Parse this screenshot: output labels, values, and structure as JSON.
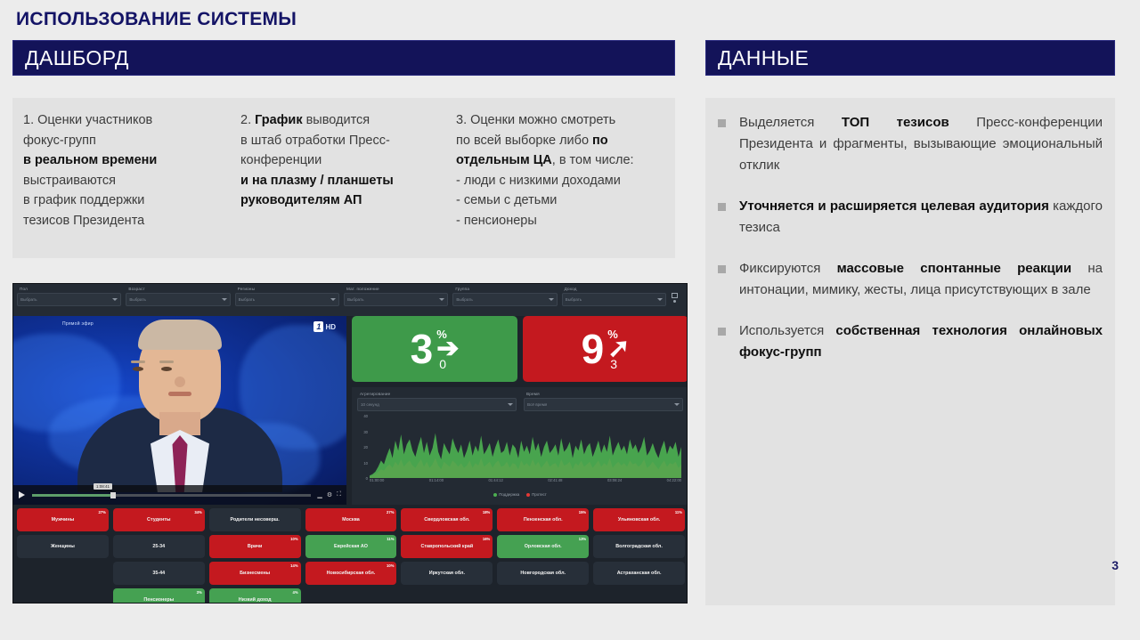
{
  "slide": {
    "title": "ИСПОЛЬЗОВАНИЕ СИСТЕМЫ",
    "page_number": "3",
    "accent_navy": "#131359",
    "panel_grey": "#e2e2e2",
    "slide_bg": "#ececec"
  },
  "headers": {
    "dashboard": "ДАШБОРД",
    "data": "ДАННЫЕ"
  },
  "columns": [
    {
      "id": "col-1",
      "segments": [
        {
          "text": "1. Оценки участников\nфокус-групп\n",
          "bold": false
        },
        {
          "text": "в реальном времени",
          "bold": true
        },
        {
          "text": "\nвыстраиваются\nв график поддержки\nтезисов Президента",
          "bold": false
        }
      ]
    },
    {
      "id": "col-2",
      "segments": [
        {
          "text": "2. ",
          "bold": false
        },
        {
          "text": "График",
          "bold": true
        },
        {
          "text": " выводится\nв штаб отработки Пресс-\nконференции\n",
          "bold": false
        },
        {
          "text": "и на плазму / планшеты\nруководителям АП",
          "bold": true
        }
      ]
    },
    {
      "id": "col-3",
      "segments": [
        {
          "text": "3. Оценки можно смотреть\nпо всей выборке либо ",
          "bold": false
        },
        {
          "text": "по\nотдельным ЦА",
          "bold": true
        },
        {
          "text": ", в том числе:\n- люди с низкими доходами\n- семьи с детьми\n- пенсионеры",
          "bold": false
        }
      ]
    }
  ],
  "data_bullets": [
    {
      "id": "bullet-1",
      "segments": [
        {
          "text": "Выделяется ",
          "bold": false
        },
        {
          "text": "ТОП тезисов",
          "bold": true
        },
        {
          "text": " Пресс-конференции Президента и фрагменты, вызывающие эмоциональный отклик",
          "bold": false
        }
      ]
    },
    {
      "id": "bullet-2",
      "segments": [
        {
          "text": "Уточняется и расширяется целевая аудитория",
          "bold": true
        },
        {
          "text": " каждого тезиса",
          "bold": false
        }
      ]
    },
    {
      "id": "bullet-3",
      "segments": [
        {
          "text": "Фиксируются ",
          "bold": false
        },
        {
          "text": "массовые спонтанные реакции",
          "bold": true
        },
        {
          "text": " на интонации, мимику, жесты, лица присутствующих в зале",
          "bold": false
        }
      ]
    },
    {
      "id": "bullet-4",
      "segments": [
        {
          "text": "Используется ",
          "bold": false
        },
        {
          "text": "собственная технология онлайновых фокус-групп",
          "bold": true
        }
      ]
    }
  ],
  "dashboard": {
    "toolbar_filters": [
      {
        "label": "Пол",
        "value": "Выбрать"
      },
      {
        "label": "Возраст",
        "value": "Выбрать"
      },
      {
        "label": "Регионы",
        "value": "Выбрать"
      },
      {
        "label": "Мат. положение",
        "value": "Выбрать"
      },
      {
        "label": "Группа",
        "value": "Выбрать"
      },
      {
        "label": "Доход",
        "value": "Выбрать"
      }
    ],
    "video": {
      "live_label": "Прямой эфир",
      "channel_logo_mark": "1",
      "channel_logo_hd": "HD",
      "time_tooltip": "1:08:41",
      "progress_percent": 28
    },
    "kpi": [
      {
        "id": "kpi-green",
        "value": "3",
        "percent_symbol": "%",
        "arrow": "➔",
        "sub": "0",
        "color": "#3e9a4a"
      },
      {
        "id": "kpi-red",
        "value": "9",
        "percent_symbol": "%",
        "arrow": "➚",
        "sub": "3",
        "color": "#c4191f"
      }
    ],
    "chart_filters": [
      {
        "label": "Агрегирование",
        "value": "10 секунд"
      },
      {
        "label": "Время",
        "value": "Всё время"
      }
    ],
    "segment_tiles": [
      {
        "label": "Мужчины",
        "pct": "27%",
        "state": "red"
      },
      {
        "label": "Студенты",
        "pct": "34%",
        "state": "red"
      },
      {
        "label": "Родители несоверш.",
        "pct": "",
        "state": "neutral"
      },
      {
        "label": "Москва",
        "pct": "27%",
        "state": "red"
      },
      {
        "label": "Свердловская обл.",
        "pct": "18%",
        "state": "red"
      },
      {
        "label": "Пензенская обл.",
        "pct": "15%",
        "state": "red"
      },
      {
        "label": "Ульяновская обл.",
        "pct": "11%",
        "state": "red"
      },
      {
        "label": "Женщины",
        "pct": "",
        "state": "neutral"
      },
      {
        "label": "25-34",
        "pct": "",
        "state": "neutral"
      },
      {
        "label": "Врачи",
        "pct": "10%",
        "state": "red"
      },
      {
        "label": "Еврейская АО",
        "pct": "11%",
        "state": "green"
      },
      {
        "label": "Ставропольский край",
        "pct": "16%",
        "state": "red"
      },
      {
        "label": "Орловская обл.",
        "pct": "13%",
        "state": "green"
      },
      {
        "label": "Волгоградская обл.",
        "pct": "",
        "state": "neutral"
      },
      {
        "label": "",
        "pct": "",
        "state": "empty"
      },
      {
        "label": "35-44",
        "pct": "",
        "state": "neutral"
      },
      {
        "label": "Бизнесмены",
        "pct": "14%",
        "state": "red"
      },
      {
        "label": "Новосибирская обл.",
        "pct": "10%",
        "state": "red"
      },
      {
        "label": "Иркутская обл.",
        "pct": "",
        "state": "neutral"
      },
      {
        "label": "Новгородская обл.",
        "pct": "",
        "state": "neutral"
      },
      {
        "label": "Астраханская обл.",
        "pct": "",
        "state": "neutral"
      },
      {
        "label": "",
        "pct": "",
        "state": "empty"
      },
      {
        "label": "Пенсионеры",
        "pct": "3%",
        "state": "green"
      },
      {
        "label": "Низкий доход",
        "pct": "4%",
        "state": "green"
      },
      {
        "label": "",
        "pct": "",
        "state": "empty"
      },
      {
        "label": "",
        "pct": "",
        "state": "empty"
      },
      {
        "label": "",
        "pct": "",
        "state": "empty"
      },
      {
        "label": "",
        "pct": "",
        "state": "empty"
      }
    ]
  },
  "chart_data": {
    "type": "area",
    "title": "",
    "xlabel": "",
    "ylabel": "",
    "ylim": [
      0,
      50
    ],
    "grid": false,
    "legend_position": "bottom",
    "y_ticks": [
      "40",
      "30",
      "20",
      "10",
      "0"
    ],
    "x_ticks": [
      "01:00:00",
      "01:14:00",
      "01:44:12",
      "02:41:48",
      "03:08:24",
      "04:22:00"
    ],
    "series": [
      {
        "name": "Поддержка",
        "color": "#4caf50",
        "values": [
          2,
          3,
          5,
          9,
          14,
          11,
          18,
          24,
          16,
          30,
          22,
          35,
          19,
          27,
          31,
          22,
          17,
          26,
          33,
          20,
          29,
          18,
          24,
          36,
          21,
          15,
          28,
          23,
          19,
          32,
          25,
          20,
          27,
          16,
          22,
          30,
          18,
          26,
          21,
          34,
          19,
          23,
          28,
          17,
          25,
          31,
          20,
          22,
          29,
          18,
          27,
          24,
          16,
          30,
          21,
          26,
          19,
          33,
          22,
          28,
          17,
          25,
          30,
          20,
          23,
          27,
          18,
          32,
          21,
          24,
          29,
          16,
          26,
          22,
          31,
          19,
          25,
          28,
          17,
          23,
          30,
          20,
          27,
          21,
          34,
          18,
          24,
          29,
          22,
          26,
          19,
          31,
          23,
          27,
          20,
          25,
          33,
          18,
          22,
          28,
          21,
          16,
          24,
          30,
          19,
          26,
          23,
          29,
          17,
          25
        ]
      },
      {
        "name": "Протест",
        "color": "#e53935",
        "values": [
          1,
          2,
          3,
          5,
          7,
          6,
          9,
          11,
          8,
          13,
          10,
          15,
          9,
          12,
          14,
          10,
          8,
          12,
          15,
          9,
          13,
          8,
          11,
          16,
          10,
          7,
          13,
          11,
          9,
          14,
          12,
          9,
          12,
          8,
          10,
          14,
          8,
          12,
          10,
          16,
          9,
          11,
          13,
          8,
          12,
          14,
          9,
          10,
          13,
          8,
          12,
          11,
          7,
          14,
          10,
          12,
          9,
          15,
          10,
          13,
          8,
          11,
          14,
          9,
          11,
          12,
          8,
          15,
          10,
          11,
          13,
          7,
          12,
          10,
          14,
          9,
          11,
          13,
          8,
          11,
          14,
          9,
          12,
          10,
          16,
          8,
          11,
          13,
          10,
          12,
          9,
          14,
          11,
          12,
          9,
          11,
          15,
          8,
          10,
          13,
          10,
          7,
          11,
          14,
          9,
          12,
          11,
          13,
          8,
          11
        ]
      }
    ]
  }
}
